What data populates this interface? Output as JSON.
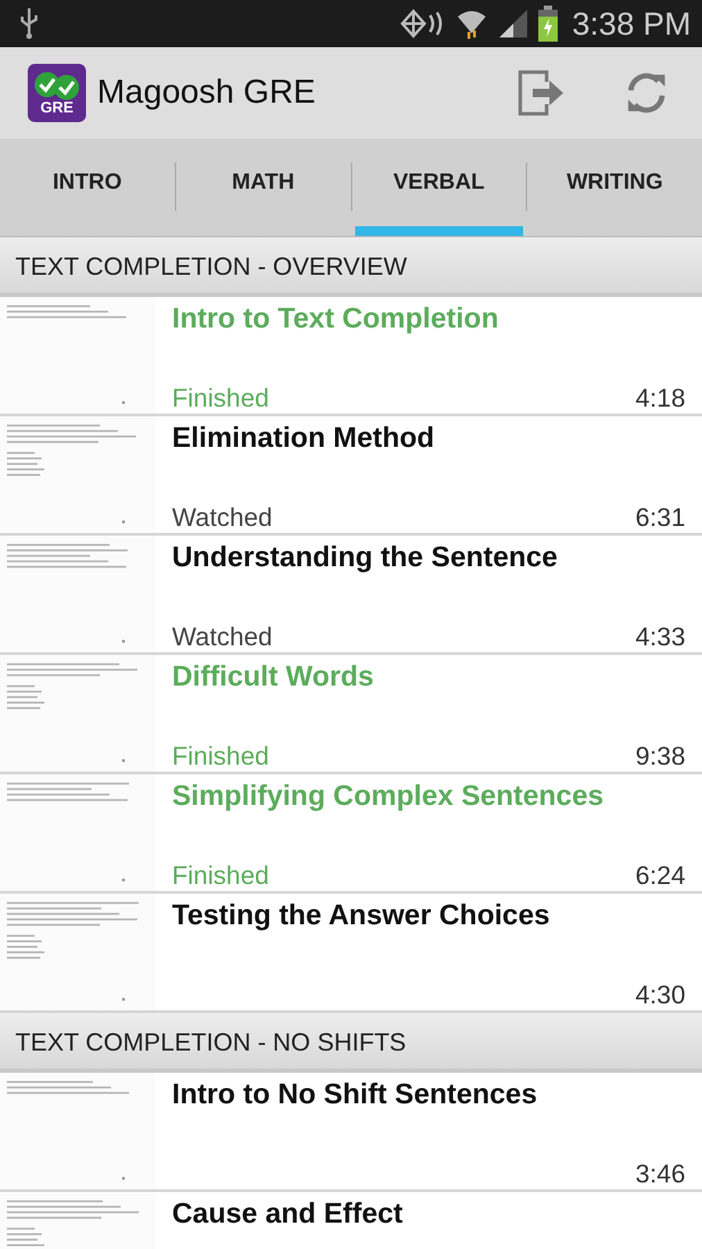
{
  "status_bar": {
    "time": "3:38 PM"
  },
  "app_bar": {
    "title": "Magoosh GRE",
    "logo_text": "GRE"
  },
  "tabs": [
    {
      "label": "INTRO",
      "selected": false
    },
    {
      "label": "MATH",
      "selected": false
    },
    {
      "label": "VERBAL",
      "selected": true
    },
    {
      "label": "WRITING",
      "selected": false
    }
  ],
  "sections": [
    {
      "title": "TEXT COMPLETION - OVERVIEW",
      "lessons": [
        {
          "title": "Intro to Text Completion",
          "status": {
            "kind": "finished",
            "label": "Finished"
          },
          "duration": "4:18"
        },
        {
          "title": "Elimination Method",
          "status": {
            "kind": "watched",
            "label": "Watched"
          },
          "duration": "6:31"
        },
        {
          "title": "Understanding the Sentence",
          "status": {
            "kind": "watched",
            "label": "Watched"
          },
          "duration": "4:33"
        },
        {
          "title": "Difficult Words",
          "status": {
            "kind": "finished",
            "label": "Finished"
          },
          "duration": "9:38"
        },
        {
          "title": "Simplifying Complex Sentences",
          "status": {
            "kind": "finished",
            "label": "Finished"
          },
          "duration": "6:24"
        },
        {
          "title": "Testing the Answer Choices",
          "duration": "4:30"
        }
      ]
    },
    {
      "title": "TEXT COMPLETION - NO SHIFTS",
      "lessons": [
        {
          "title": "Intro to No Shift Sentences",
          "duration": "3:46"
        },
        {
          "title": "Cause and Effect"
        }
      ]
    }
  ]
}
